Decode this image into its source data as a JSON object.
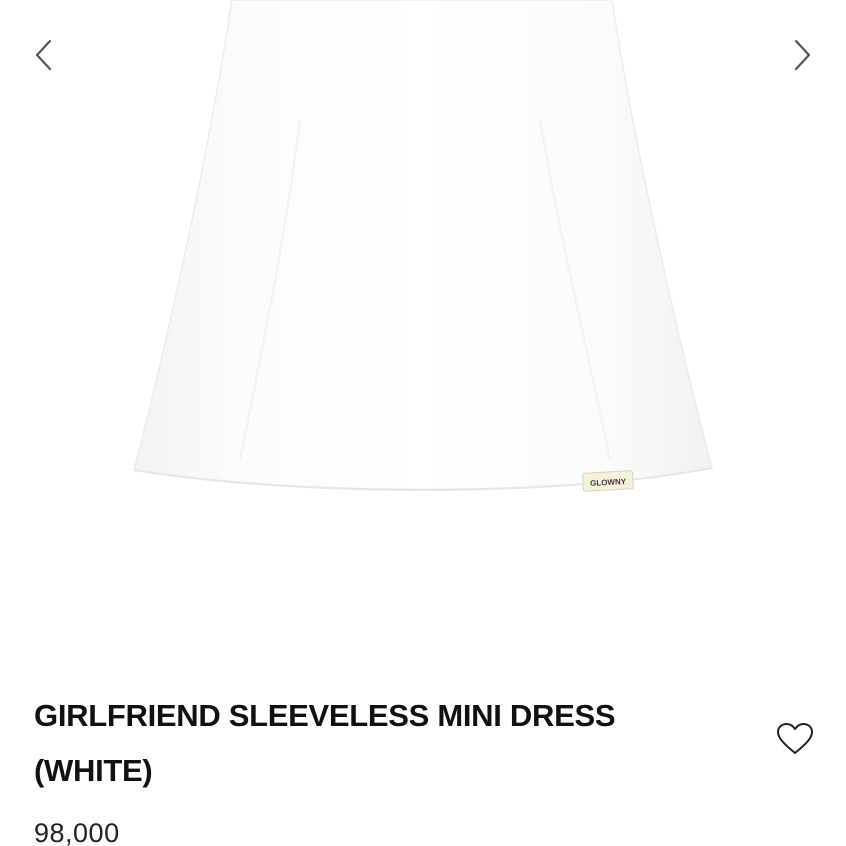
{
  "gallery": {
    "prev_icon": "chevron-left-icon",
    "next_icon": "chevron-right-icon",
    "label_text": "GLOWNY",
    "dress_color": "#ffffff",
    "label_color": "#f6f0dc"
  },
  "product": {
    "title_line1": "GIRLFRIEND SLEEVELESS MINI DRESS",
    "title_line2": "(WHITE)",
    "price": "98,000",
    "wishlist_icon": "heart-outline-icon"
  }
}
